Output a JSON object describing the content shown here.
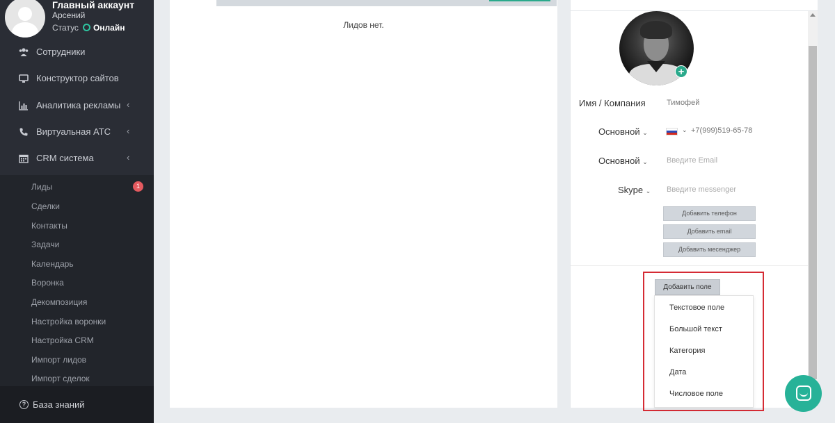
{
  "profile": {
    "account_title": "Главный аккаунт",
    "user_name": "Арсений",
    "status_label": "Статус",
    "status_value": "Онлайн",
    "status_color": "#2ec4a0"
  },
  "nav": {
    "items": [
      {
        "label": "Сотрудники",
        "icon": "users-icon"
      },
      {
        "label": "Конструктор сайтов",
        "icon": "monitor-icon"
      },
      {
        "label": "Аналитика рекламы",
        "icon": "bar-chart-icon",
        "expandable": true
      },
      {
        "label": "Виртуальная АТС",
        "icon": "phone-icon",
        "expandable": true
      },
      {
        "label": "CRM система",
        "icon": "calendar-icon",
        "expandable": true,
        "expanded": true
      }
    ],
    "chevron": "‹",
    "crm_submenu": [
      {
        "label": "Лиды",
        "badge": "1"
      },
      {
        "label": "Сделки"
      },
      {
        "label": "Контакты"
      },
      {
        "label": "Задачи"
      },
      {
        "label": "Календарь"
      },
      {
        "label": "Воронка"
      },
      {
        "label": "Декомпозиция"
      },
      {
        "label": "Настройка воронки"
      },
      {
        "label": "Настройка CRM"
      },
      {
        "label": "Импорт лидов"
      },
      {
        "label": "Импорт сделок"
      }
    ],
    "knowledge_base": {
      "label": "База знаний",
      "icon": "question-circle-icon",
      "icon_glyph": "?"
    }
  },
  "leads": {
    "empty_text": "Лидов нет."
  },
  "contact": {
    "photo_icon": "add-photo-plus-icon",
    "plus_glyph": "+",
    "name_label": "Имя / Компания",
    "name_value": "Тимофей",
    "phone_type": "Основной",
    "phone_country": "ru-flag-icon",
    "phone_value": "+7(999)519-65-78",
    "email_type": "Основной",
    "email_placeholder": "Введите Email",
    "messenger_type": "Skype",
    "messenger_placeholder": "Введите messenger",
    "add_phone": "Добавить телефон",
    "add_email": "Добавить email",
    "add_messenger": "Добавить месенджер",
    "add_field": "Добавить поле",
    "field_types": [
      "Текстовое поле",
      "Большой текст",
      "Категория",
      "Дата",
      "Числовое поле"
    ]
  },
  "colors": {
    "accent": "#2aa98b",
    "sidebar": "#2a2d35",
    "highlight_box": "#d52b34",
    "badge": "#e45a5f"
  },
  "chat": {
    "icon": "chat-icon"
  }
}
